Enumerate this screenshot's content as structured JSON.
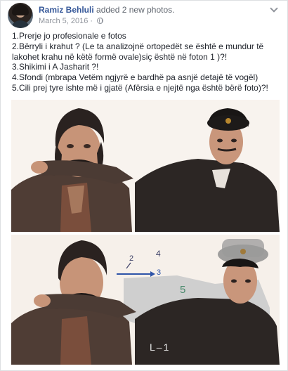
{
  "post": {
    "author": "Ramiz Behluli",
    "action": "added 2 new photos.",
    "date": "March 5, 2016",
    "date_separator": "·",
    "privacy_icon": "globe-icon",
    "menu_icon": "chevron-down-icon",
    "body_lines": [
      "1.Prerje jo profesionale e fotos",
      "2.Bërryli i krahut ? (Le ta analizojnë ortopedët se është e mundur të lakohet krahu në këtë formë ovale)siç është në foton 1 )?!",
      "3.Shikimi i A Jasharit ?!",
      "4.Sfondi (mbrapa Vetëm ngjyrë e bardhë pa asnjë detajë të vogël)",
      "5.Cili prej tyre ishte më i gjatë (Afërsia e njejtë nga është bërë foto)?!"
    ]
  },
  "photo2_annotations": {
    "n1": "1",
    "n2": "2",
    "n3": "3",
    "n4": "4",
    "n5": "5",
    "colors": {
      "arrow": "#2e54a8",
      "n5": "#4a8a6d",
      "ink": "#3b3f66"
    }
  },
  "colors": {
    "author_link": "#365899",
    "meta_gray": "#90949c",
    "text": "#1d2129"
  }
}
